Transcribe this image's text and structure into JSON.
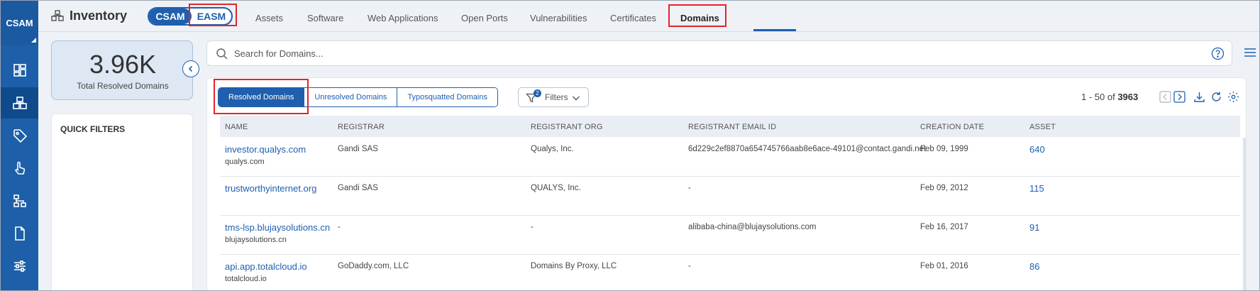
{
  "rail": {
    "logo": "CSAM"
  },
  "header": {
    "title": "Inventory",
    "toggle": {
      "csam": "CSAM",
      "easm": "EASM"
    },
    "tabs": [
      "Assets",
      "Software",
      "Web Applications",
      "Open Ports",
      "Vulnerabilities",
      "Certificates",
      "Domains"
    ],
    "active_tab": "Domains"
  },
  "stats": {
    "value": "3.96K",
    "label": "Total Resolved Domains"
  },
  "quick_filters": {
    "title": "QUICK FILTERS"
  },
  "search": {
    "placeholder": "Search for Domains..."
  },
  "segments": [
    "Resolved Domains",
    "Unresolved Domains",
    "Typosquatted Domains"
  ],
  "active_segment": "Resolved Domains",
  "filters": {
    "label": "Filters",
    "count": "2"
  },
  "pager": {
    "range": "1 - 50 of",
    "total": "3963"
  },
  "table": {
    "columns": [
      "NAME",
      "REGISTRAR",
      "REGISTRANT ORG",
      "REGISTRANT EMAIL ID",
      "CREATION DATE",
      "ASSET"
    ],
    "rows": [
      {
        "name": "investor.qualys.com",
        "sub": "qualys.com",
        "registrar": "Gandi SAS",
        "org": "Qualys, Inc.",
        "email": "6d229c2ef8870a654745766aab8e6ace-49101@contact.gandi.net",
        "date": "Feb 09, 1999",
        "asset": "640"
      },
      {
        "name": "trustworthyinternet.org",
        "sub": "",
        "registrar": "Gandi SAS",
        "org": "QUALYS, Inc.",
        "email": "-",
        "date": "Feb 09, 2012",
        "asset": "115"
      },
      {
        "name": "tms-lsp.blujaysolutions.cn",
        "sub": "blujaysolutions.cn",
        "registrar": "-",
        "org": "-",
        "email": "alibaba-china@blujaysolutions.com",
        "date": "Feb 16, 2017",
        "asset": "91"
      },
      {
        "name": "api.app.totalcloud.io",
        "sub": "totalcloud.io",
        "registrar": "GoDaddy.com, LLC",
        "org": "Domains By Proxy, LLC",
        "email": "-",
        "date": "Feb 01, 2016",
        "asset": "86"
      }
    ]
  },
  "colors": {
    "accent": "#1f5fae",
    "rail": "#1d5fa8",
    "highlight": "#e0262b"
  }
}
